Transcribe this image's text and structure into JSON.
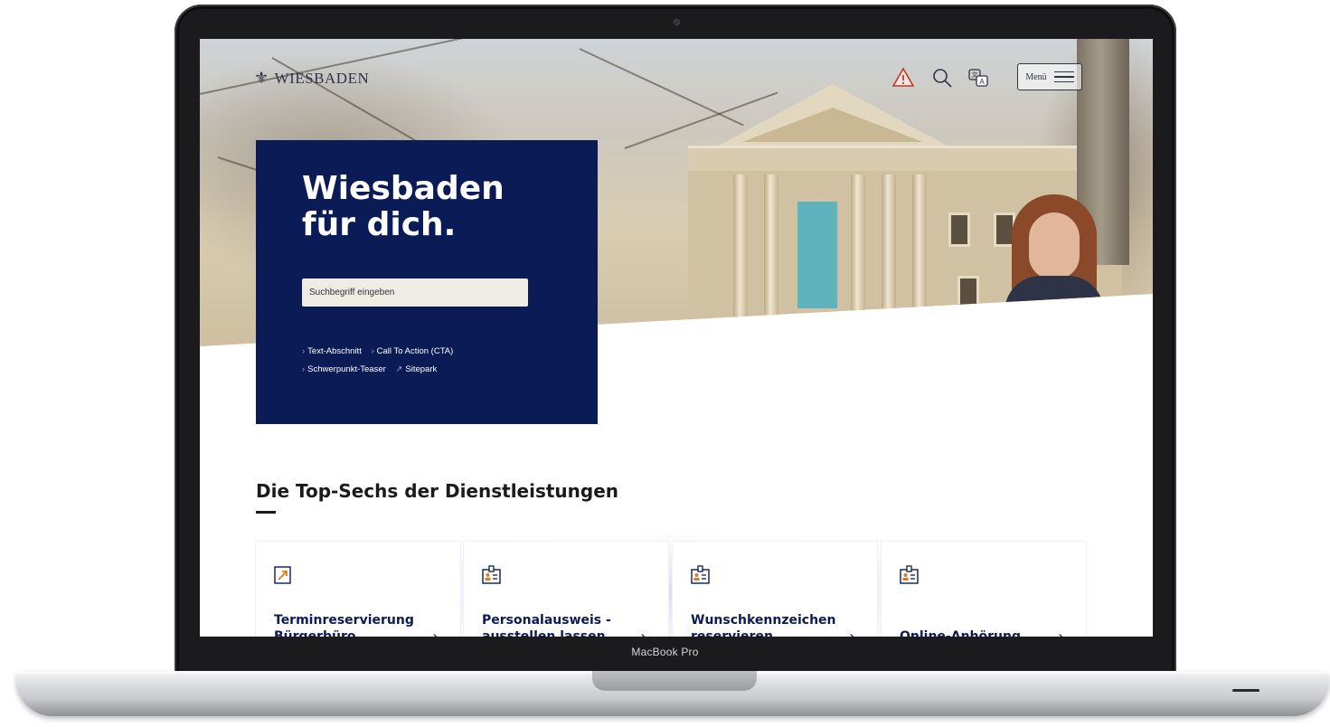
{
  "device": {
    "brand_label": "MacBook Pro"
  },
  "header": {
    "logo_text": "WIESBADEN",
    "menu_label": "Menü",
    "icons": [
      "warning-icon",
      "search-icon",
      "translate-icon",
      "hamburger-icon"
    ]
  },
  "hero": {
    "title_line1": "Wiesbaden",
    "title_line2": "für dich.",
    "search_placeholder": "Suchbegriff eingeben",
    "links": [
      {
        "label": "Text-Abschnitt",
        "icon": "chevron-right-icon"
      },
      {
        "label": "Call To Action (CTA)",
        "icon": "chevron-right-icon"
      },
      {
        "label": "Schwerpunkt-Teaser",
        "icon": "chevron-right-icon"
      },
      {
        "label": "Sitepark",
        "icon": "external-link-icon"
      }
    ]
  },
  "services": {
    "title": "Die Top-Sechs der Dienstleistungen",
    "cards": [
      {
        "title": "Terminreservierung Bürgerbüro",
        "icon": "external-calendar-icon"
      },
      {
        "title": "Personalausweis - ausstellen lassen",
        "icon": "id-badge-icon"
      },
      {
        "title": "Wunschkennzeichen reservieren",
        "icon": "id-badge-icon"
      },
      {
        "title": "Online-Anhörung",
        "icon": "id-badge-icon"
      }
    ]
  },
  "colors": {
    "navy": "#0b1b55",
    "accent_orange": "#e07a1f",
    "warning_red": "#c0392b",
    "input_bg": "#efece6"
  }
}
